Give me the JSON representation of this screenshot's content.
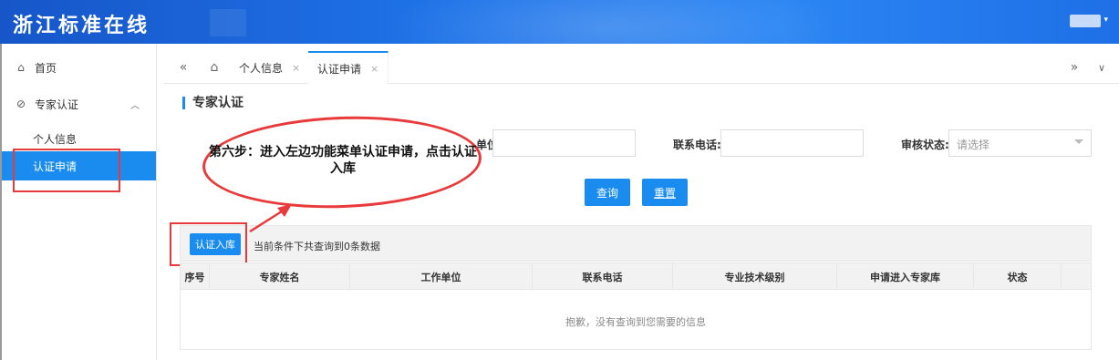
{
  "app": {
    "title": "浙江标准在线"
  },
  "sidebar": {
    "home": "首页",
    "expert": "专家认证",
    "sub": {
      "personal": "个人信息",
      "certification": "认证申请"
    }
  },
  "tabs": {
    "items": [
      {
        "label": "个人信息",
        "close": "×"
      },
      {
        "label": "认证申请",
        "close": "×"
      }
    ],
    "nav_back": "«",
    "nav_forward": "»",
    "more": "∨"
  },
  "page": {
    "title": "专家认证",
    "annotation": "第六步：进入左边功能菜单认证申请，点击认证入库",
    "filters": {
      "unit_label": "单位:",
      "phone_label": "联系电话:",
      "status_label": "审核状态:",
      "status_placeholder": "请选择"
    },
    "buttons": {
      "query": "查询",
      "reset": "重置",
      "certify": "认证入库"
    },
    "result_count": "当前条件下共查询到0条数据",
    "table": {
      "headers": [
        "序号",
        "专家姓名",
        "工作单位",
        "联系电话",
        "专业技术级别",
        "申请进入专家库",
        "状态"
      ],
      "empty_text": "抱歉，没有查询到您需要的信息"
    }
  },
  "colors": {
    "accent": "#1a8cf0",
    "annotation_red": "#e83a3a",
    "header_blue": "#1f73e8"
  }
}
